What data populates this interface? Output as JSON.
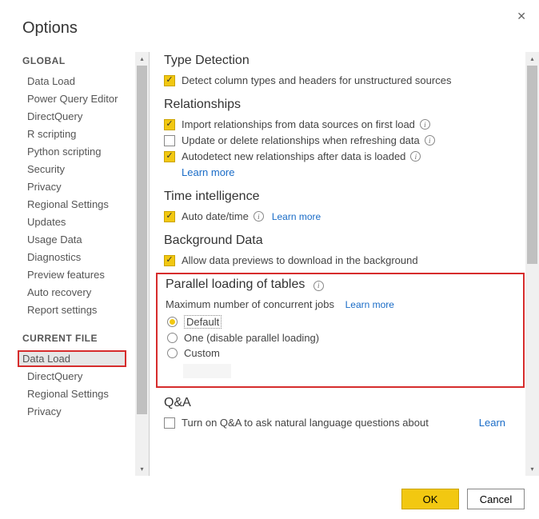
{
  "dialog": {
    "title": "Options",
    "ok": "OK",
    "cancel": "Cancel"
  },
  "sidebar": {
    "globalHeader": "GLOBAL",
    "currentFileHeader": "CURRENT FILE",
    "global": [
      "Data Load",
      "Power Query Editor",
      "DirectQuery",
      "R scripting",
      "Python scripting",
      "Security",
      "Privacy",
      "Regional Settings",
      "Updates",
      "Usage Data",
      "Diagnostics",
      "Preview features",
      "Auto recovery",
      "Report settings"
    ],
    "currentFile": [
      "Data Load",
      "DirectQuery",
      "Regional Settings",
      "Privacy"
    ]
  },
  "main": {
    "typeDetection": {
      "heading": "Type Detection",
      "opt1": "Detect column types and headers for unstructured sources"
    },
    "relationships": {
      "heading": "Relationships",
      "opt1": "Import relationships from data sources on first load",
      "opt2": "Update or delete relationships when refreshing data",
      "opt3": "Autodetect new relationships after data is loaded",
      "learn": "Learn more"
    },
    "timeIntel": {
      "heading": "Time intelligence",
      "opt1": "Auto date/time",
      "learn": "Learn more"
    },
    "bgData": {
      "heading": "Background Data",
      "opt1": "Allow data previews to download in the background"
    },
    "parallel": {
      "heading": "Parallel loading of tables",
      "sub": "Maximum number of concurrent jobs",
      "learn": "Learn more",
      "r1": "Default",
      "r2": "One (disable parallel loading)",
      "r3": "Custom"
    },
    "qa": {
      "heading": "Q&A",
      "opt1": "Turn on Q&A to ask natural language questions about",
      "learn": "Learn"
    }
  }
}
